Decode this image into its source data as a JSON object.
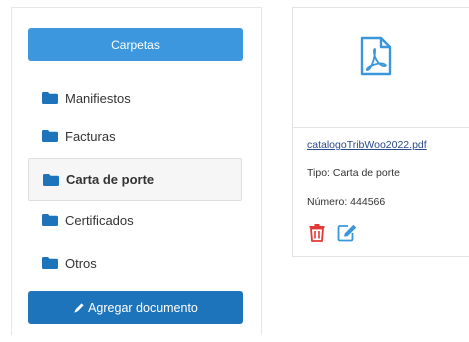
{
  "sidebar": {
    "header_button": "Carpetas",
    "items": [
      {
        "label": "Manifiestos",
        "active": false
      },
      {
        "label": "Facturas",
        "active": false
      },
      {
        "label": "Carta de porte",
        "active": true
      },
      {
        "label": "Certificados",
        "active": false
      },
      {
        "label": "Otros",
        "active": false
      }
    ],
    "add_button": "Agregar documento",
    "item_icon": "folder-icon",
    "add_icon": "pencil-icon"
  },
  "document": {
    "file_icon": "pdf-file-icon",
    "file_name": "catalogoTribWoo2022.pdf",
    "type_text": "Tipo: Carta de porte",
    "number_text": "Número: 444566",
    "delete_icon": "trash-icon",
    "edit_icon": "edit-icon"
  },
  "colors": {
    "primary_button": "#3c97de",
    "add_button": "#1e74ba",
    "folder_icon": "#1e74ba",
    "pdf_icon": "#3b97dc",
    "delete": "#e53935",
    "edit": "#3b97dc"
  }
}
